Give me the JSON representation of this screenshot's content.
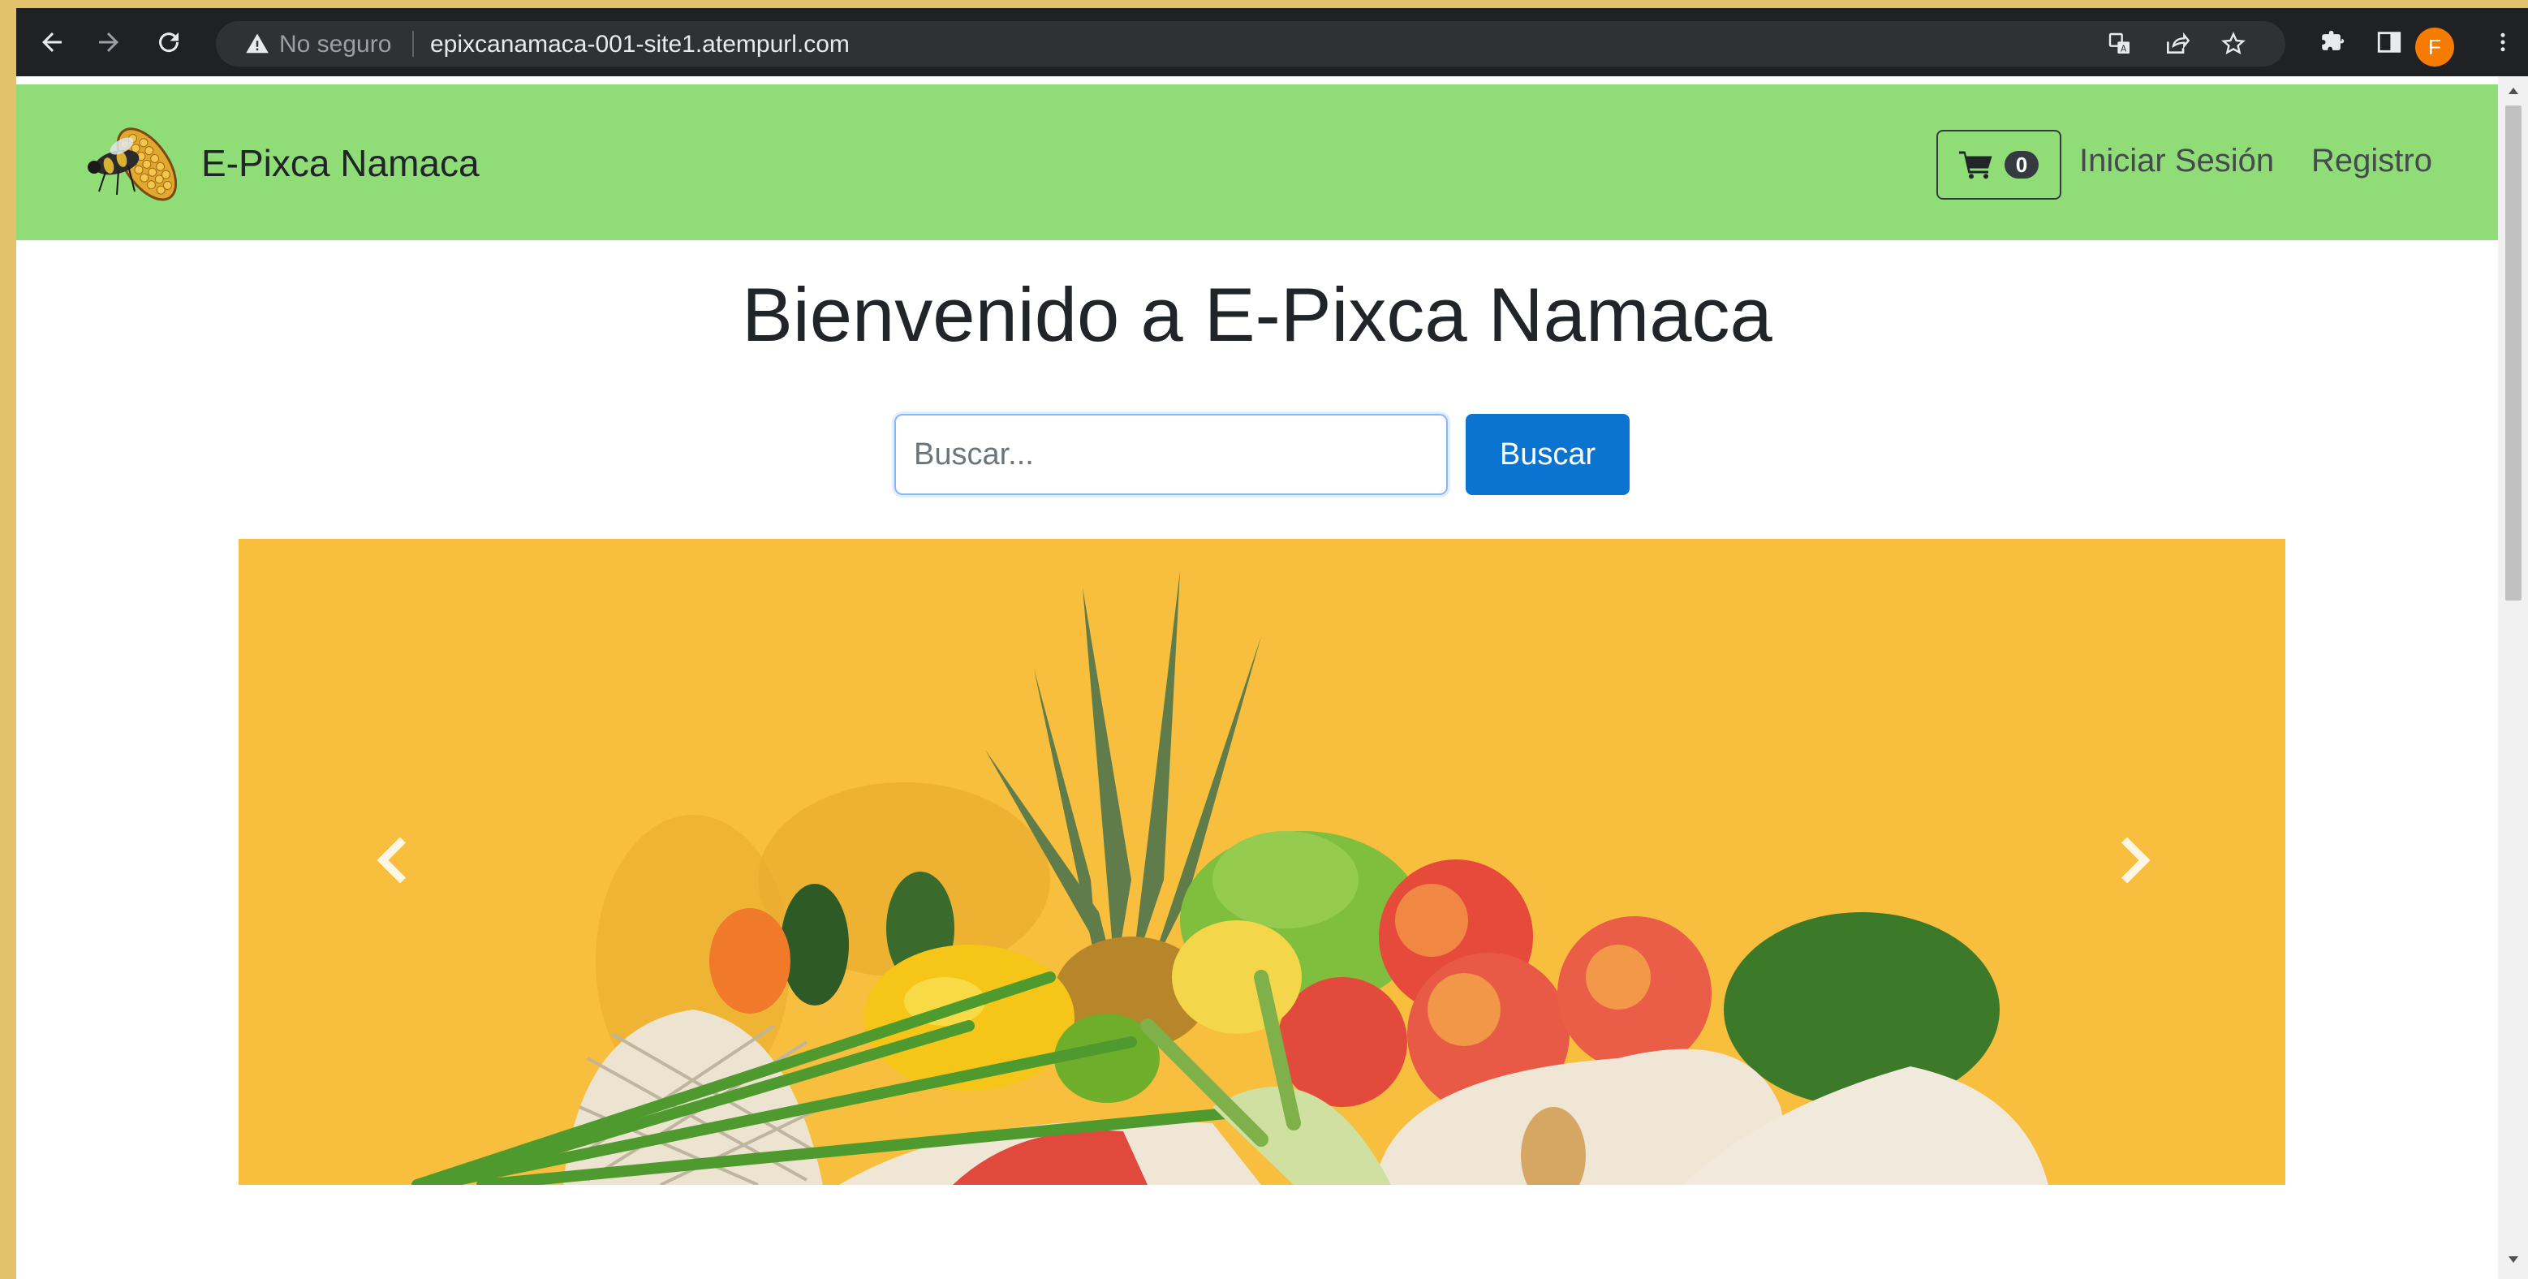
{
  "browser": {
    "security_label": "No seguro",
    "url": "epixcanamaca-001-site1.atempurl.com",
    "profile_initial": "F",
    "icons": [
      "back-icon",
      "forward-icon",
      "reload-icon",
      "warning-icon",
      "translate-icon",
      "share-icon",
      "star-icon",
      "extensions-icon",
      "side-panel-icon",
      "menu-icon"
    ]
  },
  "navbar": {
    "brand": "E-Pixca Namaca",
    "cart_count": "0",
    "login": "Iniciar Sesión",
    "register": "Registro",
    "icons": [
      "corn-bee-logo",
      "cart-icon"
    ]
  },
  "main": {
    "title": "Bienvenido a E-Pixca Namaca",
    "search": {
      "placeholder": "Buscar...",
      "button": "Buscar"
    }
  },
  "carousel": {
    "slide_count_visible": 1,
    "image": "fruits-and-vegetables-photo",
    "icons": [
      "chevron-left-icon",
      "chevron-right-icon"
    ]
  },
  "colors": {
    "navbar": "#90dd78",
    "primary_button": "#0a74d0",
    "carousel_bg": "#f8be3d",
    "page_bg": "#e2c26a"
  }
}
